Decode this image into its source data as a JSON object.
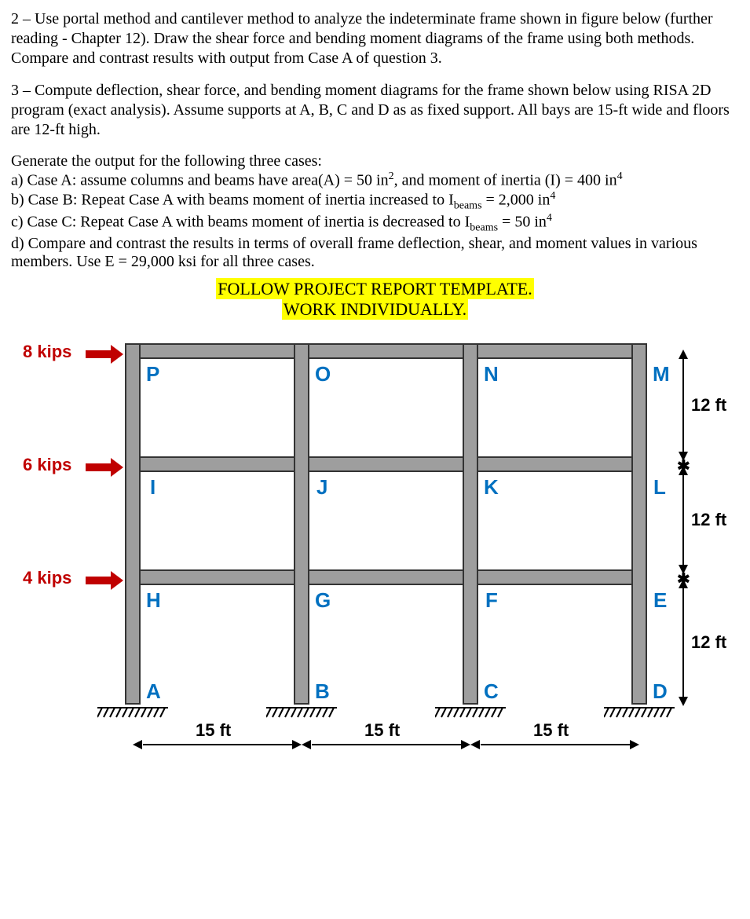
{
  "problem2": "2 – Use portal method and cantilever method to analyze the indeterminate frame shown in figure below (further reading - Chapter 12). Draw the shear force and bending moment diagrams of the frame using both methods. Compare and contrast results with output from Case A of question 3.",
  "problem3_intro": "3 – Compute deflection, shear force, and bending moment diagrams for the frame shown below using RISA 2D program (exact analysis). Assume supports at A, B, C and D as as fixed support. All bays are 15-ft wide and floors are 12-ft high.",
  "cases_intro": "Generate the output for the following three cases:",
  "case_a_prefix": "a) Case A: assume columns and beams have area(A) = 50 in",
  "case_a_mid": ", and moment of inertia (I) = 400 in",
  "case_b_prefix": "b) Case B: Repeat Case A with beams moment of inertia increased to I",
  "case_b_sub": "beams",
  "case_b_suffix": " = 2,000 in",
  "case_c_prefix": "c) Case C: Repeat Case A with beams moment of inertia is decreased to I",
  "case_c_suffix": " = 50 in",
  "case_d": "d) Compare and contrast the results in terms of overall frame deflection, shear, and moment values in various members. Use E = 29,000 ksi for all three cases.",
  "highlight1": "FOLLOW PROJECT REPORT TEMPLATE.",
  "highlight2": "WORK INDIVIDUALLY.",
  "loads": {
    "top": "8 kips",
    "mid": "6 kips",
    "bot": "4 kips"
  },
  "nodes": {
    "P": "P",
    "O": "O",
    "N": "N",
    "M": "M",
    "I": "I",
    "J": "J",
    "K": "K",
    "L": "L",
    "H": "H",
    "G": "G",
    "F": "F",
    "E": "E",
    "A": "A",
    "B": "B",
    "C": "C",
    "D": "D"
  },
  "dims": {
    "bay": "15 ft",
    "story": "12 ft"
  },
  "chart_data": {
    "type": "diagram",
    "description": "3-story, 3-bay rigid frame with fixed supports at base",
    "bays_ft": [
      15,
      15,
      15
    ],
    "stories_ft": [
      12,
      12,
      12
    ],
    "supports": [
      "A",
      "B",
      "C",
      "D"
    ],
    "support_type": "fixed",
    "lateral_loads_kips": [
      {
        "level": "3 (roof)",
        "value": 8
      },
      {
        "level": "2",
        "value": 6
      },
      {
        "level": "1",
        "value": 4
      }
    ],
    "joint_labels_by_level": {
      "base": [
        "A",
        "B",
        "C",
        "D"
      ],
      "level1": [
        "H",
        "G",
        "F",
        "E"
      ],
      "level2": [
        "I",
        "J",
        "K",
        "L"
      ],
      "roof": [
        "P",
        "O",
        "N",
        "M"
      ]
    },
    "material": {
      "E_ksi": 29000
    },
    "cases": {
      "A": {
        "A_in2": 50,
        "Ibeams_in4": 400,
        "Icolumns_in4": 400
      },
      "B": {
        "A_in2": 50,
        "Ibeams_in4": 2000,
        "Icolumns_in4": 400
      },
      "C": {
        "A_in2": 50,
        "Ibeams_in4": 50,
        "Icolumns_in4": 400
      }
    }
  }
}
